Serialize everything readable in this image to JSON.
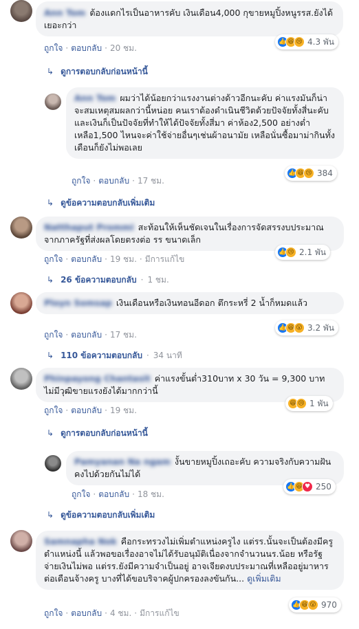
{
  "comments": {
    "c1": {
      "name": "Ann Tom",
      "text": "ต้องแดกไรเป็นอาหารคับ เงินเดือน4,000 กุขายหมูปิ้งหนูรรส.ยังได้เยอะกว่า",
      "like": "ถูกใจ",
      "reply": "ตอบกลับ",
      "time": "20 ชม.",
      "count": "4.3 พัน"
    },
    "c1_prev": "ดูการตอบกลับก่อนหน้านี้",
    "c1r": {
      "name": "Ann Tom",
      "text": "ผมว่าได้น้อยกว่าแรงงานต่างด้าวอีกนะคับ ค่าแรงมันก็น่าจะสมเหตุสมผลกว่านี้หน่อย คนเราต้องดำเนินชีวิตด้วยปัจจัยทั้งสี่นะคับและเงินก็เป็นปัจจัยที่ทำให้ได้ปัจจัยทั้งสี่มา ค่าห้อง2,500 อย่างต่ำ เหลือ1,500 ไหนจะค่าใช้จ่ายอื่นๆเช่นผ้าอนามัย เหลือนั่นซื้อมาม่ากินทั้งเดือนก็ยังไม่พอเลย",
      "like": "ถูกใจ",
      "reply": "ตอบกลับ",
      "time": "17 ชม.",
      "count": "384"
    },
    "c1_more": "ดูข้อความตอบกลับเพิ่มเติม",
    "c2": {
      "name": "Natthaput Prommi",
      "text": "สะท้อนให้เห็นชัดเจนในเรื่องการจัดสรรงบประมาณจากภาครัฐที่ส่งผลโดยตรงต่อ รร ขนาดเล็ก",
      "like": "ถูกใจ",
      "reply": "ตอบกลับ",
      "time": "19 ชม.",
      "edited": "มีการแก้ไข",
      "count": "2.1 พัน"
    },
    "c2_replies": "26 ข้อความตอบกลับ",
    "c2_replies_time": "1 ชม.",
    "c3": {
      "name": "Ployn Somsap",
      "text": "เงินเดือนหรือเงินทอนอีดอก ตึกระหรี่ 2 น้ำก็หมดแล้ว",
      "like": "ถูกใจ",
      "reply": "ตอบกลับ",
      "time": "17 ชม.",
      "count": "3.2 พัน"
    },
    "c3_replies": "110 ข้อความตอบกลับ",
    "c3_replies_time": "34 นาที",
    "c4": {
      "name": "Phinpayong Chantasit",
      "text": "ค่าแรงขั้นต่ำ310บาท x 30 วัน = 9,300 บาท ไม่มีวุฒิขายแรงยังได้มากกว่านี้",
      "like": "ถูกใจ",
      "reply": "ตอบกลับ",
      "time": "19 ชม.",
      "count": "1 พัน"
    },
    "c4_prev": "ดูการตอบกลับก่อนหน้านี้",
    "c4r": {
      "name": "Pamyanan Na ngam",
      "text": "งั้นขายหมูปิ้งเถอะคับ ความจริงกับความฝัน คงไปด้วยกันไม่ได้",
      "like": "ถูกใจ",
      "reply": "ตอบกลับ",
      "time": "18 ชม.",
      "count": "250"
    },
    "c4_more": "ดูข้อความตอบกลับเพิ่มเติม",
    "c5": {
      "name": "Samnapha Nok",
      "text": "คือกระทรวงไม่เพิ่มตำแหน่งครูไง แต่รร.นั้นจะเป็นต้องมีครูตำแหน่งนี้ แล้วพอขอเรื่องอาจไม่ได้รับอนุมัติเนื่องจากจำนวนนร.น้อย หรือรัฐจ่ายเงินไม่พอ แต่รร.ยังมีความจำเป็นอยู่ อาจเจียดงบประมาณที่เหลืออยู่มาหารต่อเดือนจ้างครู บางที่ได้ขอบริจาคผู้ปกครองลงขันกัน...",
      "see_more": "ดูเพิ่มเติม",
      "like": "ถูกใจ",
      "reply": "ตอบกลับ",
      "time": "4 ชม.",
      "edited": "มีการแก้ไข",
      "count": "970"
    }
  }
}
